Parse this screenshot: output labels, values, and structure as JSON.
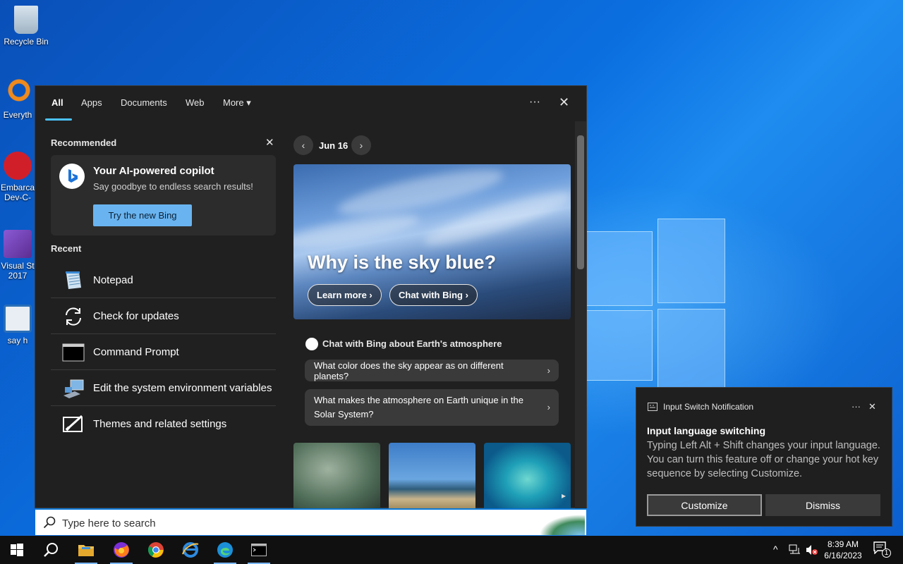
{
  "desktop": {
    "icons": [
      {
        "label": "Recycle Bin"
      },
      {
        "label": "Everyth"
      },
      {
        "label": "Embarca Dev-C-"
      },
      {
        "label": "Visual St 2017"
      },
      {
        "label": "say h"
      }
    ]
  },
  "search_panel": {
    "tabs": [
      "All",
      "Apps",
      "Documents",
      "Web",
      "More"
    ],
    "more_glyph": "▾",
    "ellipsis": "···",
    "close": "✕",
    "recommended": {
      "section_title": "Recommended",
      "card_title": "Your AI-powered copilot",
      "card_subtitle": "Say goodbye to endless search results!",
      "button_label": "Try the new Bing"
    },
    "recent": {
      "section_title": "Recent",
      "items": [
        {
          "label": "Notepad",
          "icon": "notepad-icon"
        },
        {
          "label": "Check for updates",
          "icon": "refresh-icon"
        },
        {
          "label": "Command Prompt",
          "icon": "cmd-icon"
        },
        {
          "label": "Edit the system environment variables",
          "icon": "system-icon"
        },
        {
          "label": "Themes and related settings",
          "icon": "themes-icon"
        }
      ]
    },
    "daily": {
      "prev": "‹",
      "next": "›",
      "date": "Jun 16",
      "hero_title": "Why is the sky blue?",
      "learn_more": "Learn more ›",
      "chat_with_bing": "Chat with Bing ›",
      "chat_heading": "Chat with Bing about Earth's atmosphere",
      "questions": [
        "What color does the sky appear as on different planets?",
        "What makes the atmosphere on Earth unique in the Solar System?"
      ],
      "chip_chevron": "›",
      "thumbs_next": "▸"
    },
    "search_placeholder": "Type here to search"
  },
  "notification": {
    "app_name": "Input Switch Notification",
    "ellipsis": "···",
    "close": "✕",
    "title": "Input language switching",
    "body": "Typing Left Alt + Shift changes your input language. You can turn this feature off or change your hot key sequence by selecting Customize.",
    "customize_label": "Customize",
    "dismiss_label": "Dismiss"
  },
  "taskbar": {
    "time": "8:39 AM",
    "date": "6/16/2023",
    "tray_chevron": "^",
    "notification_count": "1"
  }
}
